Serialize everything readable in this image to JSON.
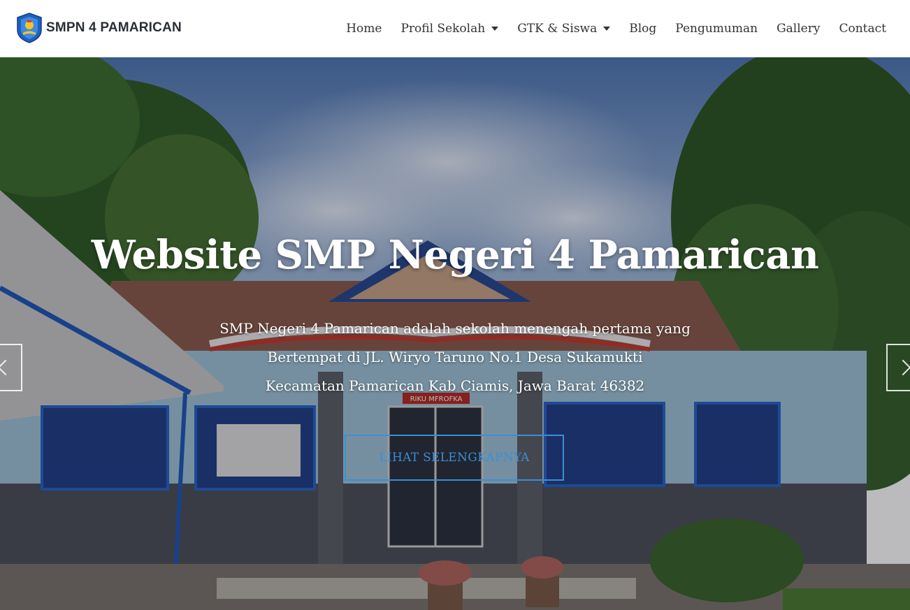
{
  "header": {
    "brand_name": "SMPN 4 PAMARICAN",
    "nav": [
      {
        "label": "Home",
        "dropdown": false
      },
      {
        "label": "Profil Sekolah",
        "dropdown": true
      },
      {
        "label": "GTK & Siswa",
        "dropdown": true
      },
      {
        "label": "Blog",
        "dropdown": false
      },
      {
        "label": "Pengumuman",
        "dropdown": false
      },
      {
        "label": "Gallery",
        "dropdown": false
      },
      {
        "label": "Contact",
        "dropdown": false
      }
    ]
  },
  "hero": {
    "title": "Website SMP Negeri 4 Pamarican",
    "description_lines": [
      "SMP Negeri 4 Pamarican adalah sekolah menengah pertama yang",
      "Bertempat di JL. Wiryo Taruno No.1 Desa Sukamukti",
      "Kecamatan Pamarican Kab Ciamis, Jawa Barat 46382"
    ],
    "cta_label": "LIHAT SELENGKAPNYA",
    "banner_text": "RIKU MFROFKA"
  },
  "colors": {
    "accent": "#3b8ed8",
    "text_dark": "#333333"
  },
  "icons": {
    "dropdown": "chevron-down-icon",
    "prev": "chevron-left-icon",
    "next": "chevron-right-icon"
  }
}
